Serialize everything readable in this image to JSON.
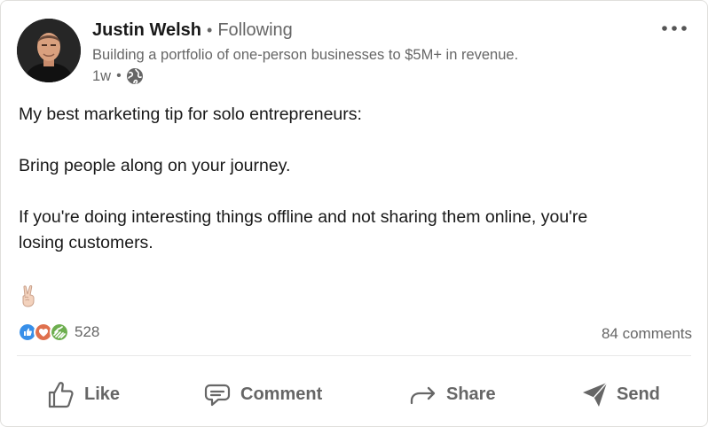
{
  "post": {
    "author": {
      "name": "Justin Welsh",
      "separator": "•",
      "follow_status": "Following",
      "headline": "Building a portfolio of one-person businesses to $5M+ in revenue.",
      "timestamp": "1w",
      "meta_separator": "•",
      "visibility_icon": "globe-icon"
    },
    "body_lines": [
      "My best marketing tip for solo entrepreneurs:",
      "Bring people along on your journey.",
      "If you're doing interesting things offline and not sharing them online, you're",
      "losing customers."
    ],
    "emoji": "victory-hand-emoji",
    "reactions": {
      "icons": [
        "like-reaction-icon",
        "love-reaction-icon",
        "celebrate-reaction-icon"
      ],
      "count": "528"
    },
    "comments": "84 comments"
  },
  "actions": {
    "like": "Like",
    "comment": "Comment",
    "share": "Share",
    "send": "Send"
  },
  "colors": {
    "primary_text": "#191919",
    "secondary_text": "#666666",
    "like_blue": "#378fe9",
    "love_red": "#df704d",
    "celebrate_green": "#44712e"
  }
}
